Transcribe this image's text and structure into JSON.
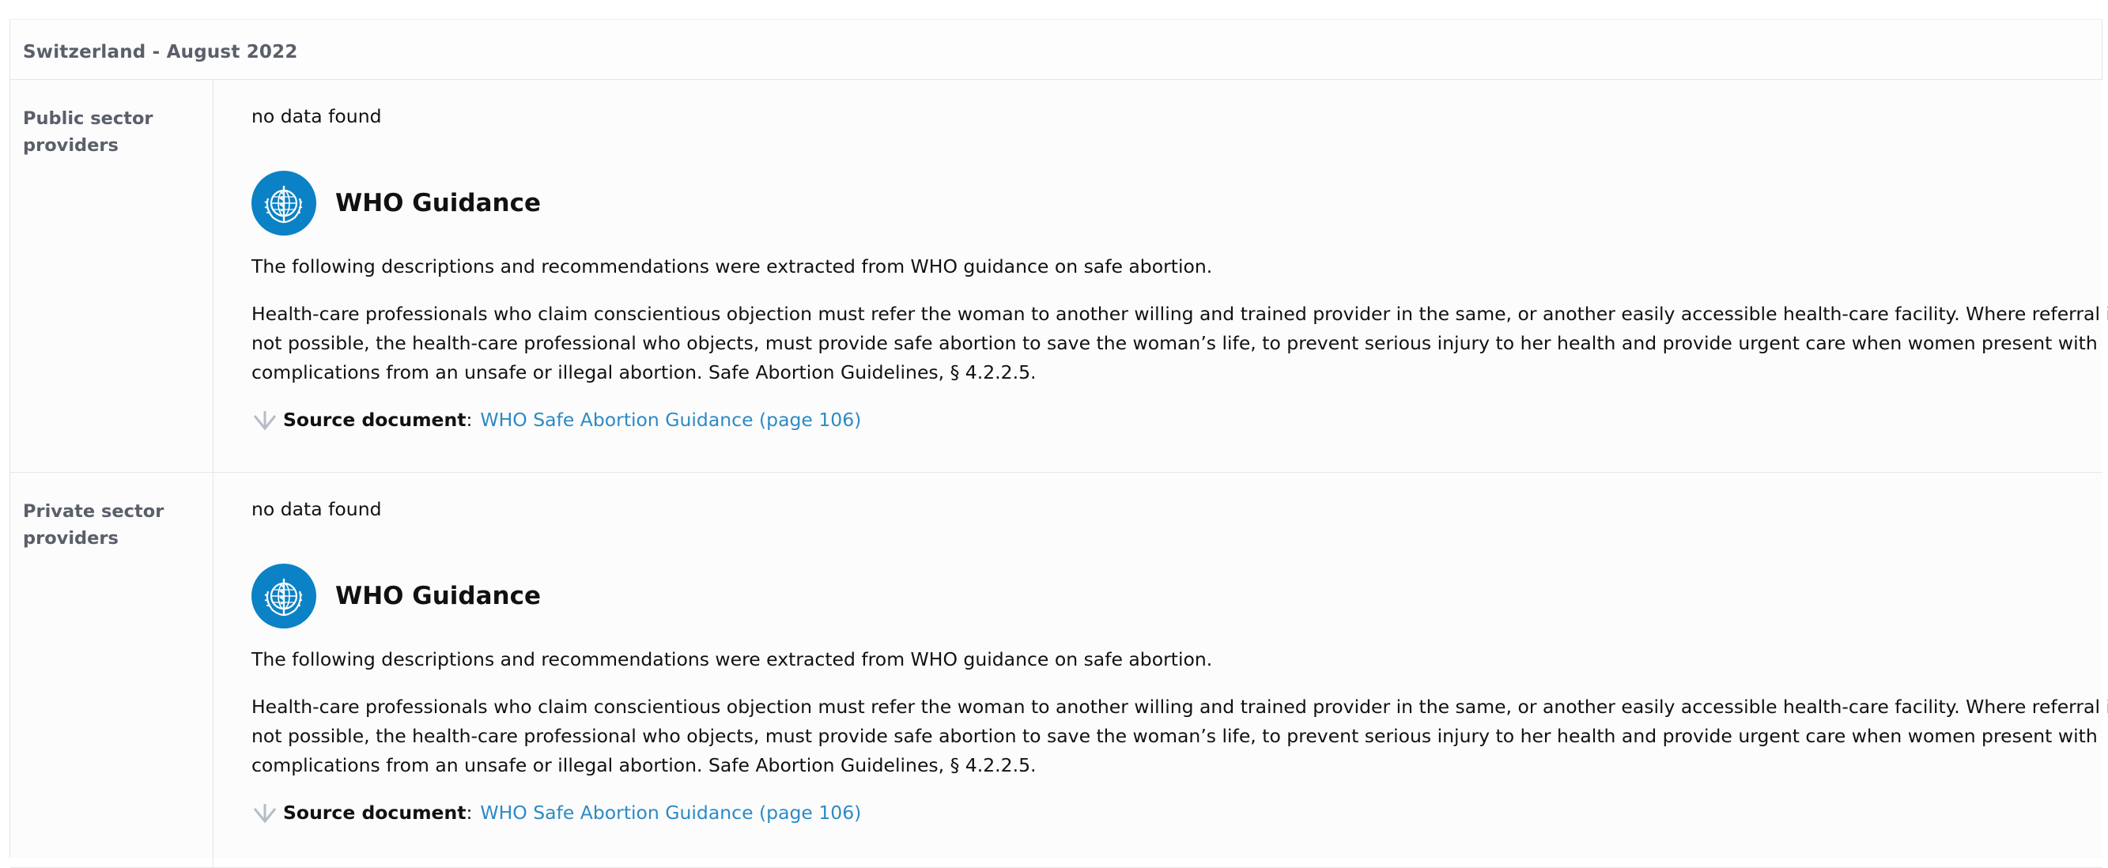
{
  "table": {
    "title": "Switzerland - August 2022"
  },
  "rows": [
    {
      "label": "Public sector providers",
      "no_data": "no data found",
      "who": {
        "title": "WHO Guidance",
        "intro": "The following descriptions and recommendations were extracted from WHO guidance on safe abortion.",
        "body": "Health-care professionals who claim conscientious objection must refer the woman to another willing and trained provider in the same, or another easily accessible health-care facility. Where referral is not possible, the health-care professional who objects, must provide safe abortion to save the woman’s life, to prevent serious injury to her health and provide urgent care when women present with complications from an unsafe or illegal abortion. Safe Abortion Guidelines, § 4.2.2.5.",
        "source_label": "Source document",
        "source_sep": ":",
        "source_link": "WHO Safe Abortion Guidance (page 106)"
      }
    },
    {
      "label": "Private sector providers",
      "no_data": "no data found",
      "who": {
        "title": "WHO Guidance",
        "intro": "The following descriptions and recommendations were extracted from WHO guidance on safe abortion.",
        "body": "Health-care professionals who claim conscientious objection must refer the woman to another willing and trained provider in the same, or another easily accessible health-care facility. Where referral is not possible, the health-care professional who objects, must provide safe abortion to save the woman’s life, to prevent serious injury to her health and provide urgent care when women present with complications from an unsafe or illegal abortion. Safe Abortion Guidelines, § 4.2.2.5.",
        "source_label": "Source document",
        "source_sep": ":",
        "source_link": "WHO Safe Abortion Guidance (page 106)"
      }
    }
  ],
  "icons": {
    "who_logo": "who-emblem-icon",
    "source_arrow": "arrow-down-icon"
  },
  "colors": {
    "who_blue": "#0b82c5",
    "link": "#2c8ac6",
    "label_gray": "#5a5f6a"
  }
}
